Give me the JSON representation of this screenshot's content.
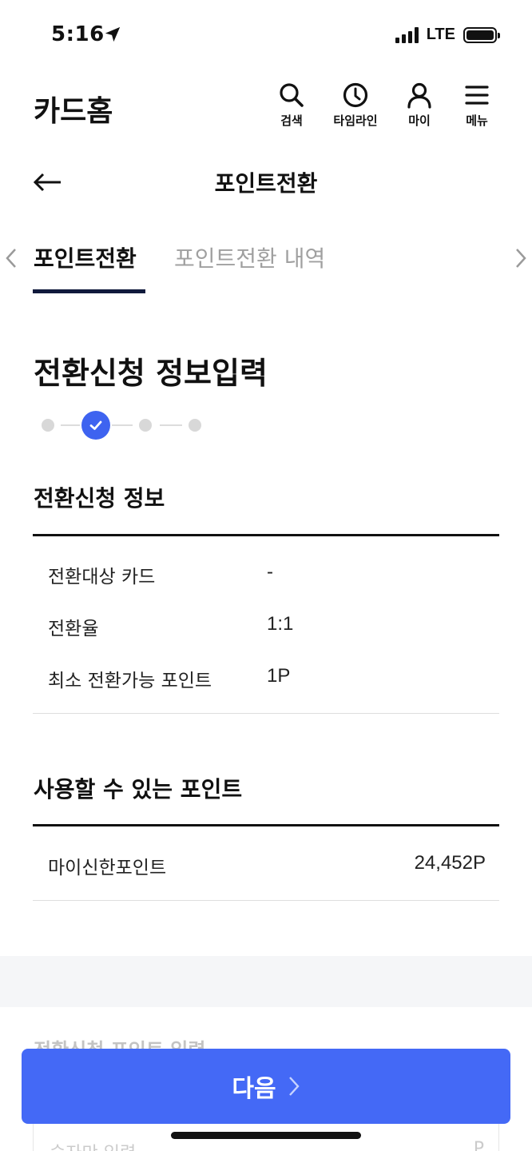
{
  "status_bar": {
    "time": "5:16",
    "network": "LTE"
  },
  "header": {
    "title": "카드홈",
    "icons": [
      {
        "name": "search-icon",
        "label": "검색"
      },
      {
        "name": "clock-icon",
        "label": "타임라인"
      },
      {
        "name": "user-icon",
        "label": "마이"
      },
      {
        "name": "menu-icon",
        "label": "메뉴"
      }
    ]
  },
  "subheader": {
    "title": "포인트전환"
  },
  "tabs": [
    {
      "label": "포인트전환",
      "active": true
    },
    {
      "label": "포인트전환 내역",
      "active": false
    }
  ],
  "page": {
    "title": "전환신청 정보입력"
  },
  "stepper": {
    "total_steps": 4,
    "current_step": 2
  },
  "conversion_info": {
    "title": "전환신청 정보",
    "rows": [
      {
        "label": "전환대상 카드",
        "value": "-"
      },
      {
        "label": "전환율",
        "value": "1:1"
      },
      {
        "label": "최소 전환가능 포인트",
        "value": "1P"
      }
    ]
  },
  "available_points": {
    "title": "사용할 수 있는 포인트",
    "rows": [
      {
        "label": "마이신한포인트",
        "value": "24,452P"
      }
    ]
  },
  "next_section": {
    "title": "전환신청 포인트 입력",
    "input_placeholder": "숫자만 입력",
    "input_unit": "P"
  },
  "footer": {
    "next_label": "다음"
  },
  "colors": {
    "accent": "#4469f6",
    "step_active": "#3e63f0",
    "tab_indicator": "#101a3c"
  }
}
